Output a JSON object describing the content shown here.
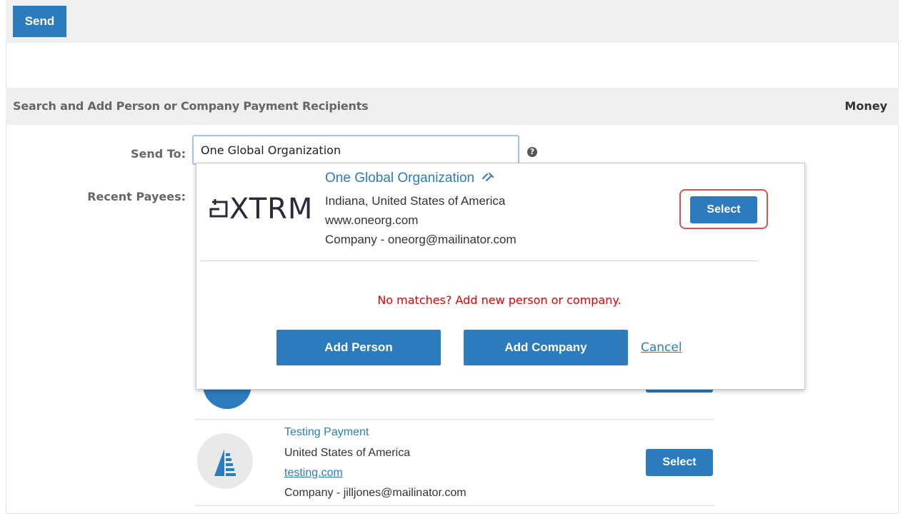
{
  "toolbar": {
    "send_label": "Send"
  },
  "section": {
    "title": "Search and Add Person or Company Payment Recipients",
    "right_label": "Money"
  },
  "form": {
    "send_to_label": "Send To:",
    "send_to_value": "One Global Organization",
    "help_glyph": "?",
    "recent_payees_label": "Recent Payees:"
  },
  "dropdown": {
    "result": {
      "logo_text": "XTRM",
      "name": "One Global Organization",
      "location": "Indiana, United States of America",
      "website": "www.oneorg.com",
      "type_email": "Company - oneorg@mailinator.com",
      "select_label": "Select"
    },
    "no_match_text": "No matches? Add new person or company.",
    "add_person_label": "Add Person",
    "add_company_label": "Add Company",
    "cancel_label": "Cancel"
  },
  "recent_payees": [
    {
      "name": "Testing Payment",
      "country": "United States of America",
      "website": "testing.com",
      "type_email": "Company - jilljones@mailinator.com",
      "select_label": "Select"
    }
  ],
  "colors": {
    "accent": "#2b7bbd",
    "error_text": "#e00000",
    "highlight": "#d9534f"
  }
}
